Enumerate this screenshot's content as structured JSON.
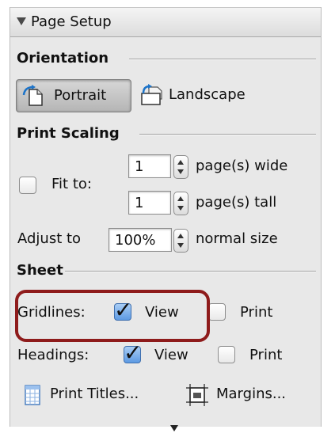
{
  "header": {
    "title": "Page Setup"
  },
  "orientation": {
    "heading": "Orientation",
    "options": [
      {
        "label": "Portrait",
        "selected": true,
        "icon": "portrait-page-icon"
      },
      {
        "label": "Landscape",
        "selected": false,
        "icon": "landscape-page-icon"
      }
    ]
  },
  "print_scaling": {
    "heading": "Print Scaling",
    "fit_to": {
      "checked": false,
      "label": "Fit to:",
      "wide_value": "1",
      "wide_label": "page(s) wide",
      "tall_value": "1",
      "tall_label": "page(s) tall"
    },
    "adjust_to": {
      "label": "Adjust to",
      "value": "100%",
      "suffix": "normal size"
    }
  },
  "sheet": {
    "heading": "Sheet",
    "gridlines": {
      "label": "Gridlines:",
      "view_label": "View",
      "view_checked": true,
      "print_label": "Print",
      "print_checked": false
    },
    "headings": {
      "label": "Headings:",
      "view_label": "View",
      "view_checked": true,
      "print_label": "Print",
      "print_checked": false
    }
  },
  "buttons": {
    "print_titles": "Print Titles...",
    "margins": "Margins..."
  },
  "colors": {
    "highlight": "#8e1b1b",
    "checkbox_checked": "#5d9ae3",
    "panel_bg": "#e8e8e8"
  }
}
